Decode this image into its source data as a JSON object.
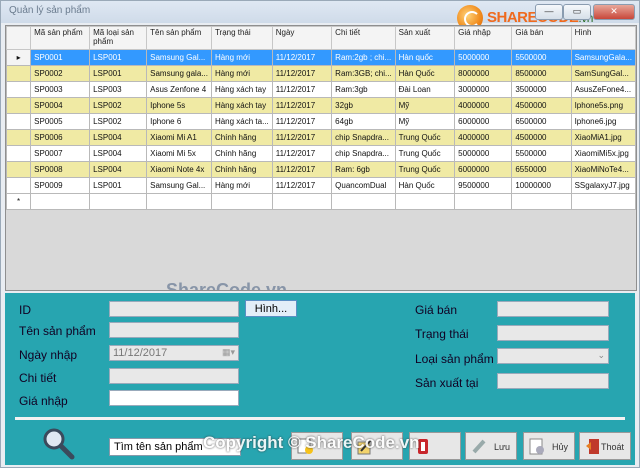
{
  "window": {
    "title": "Quản lý sản phẩm",
    "minimize_label": "—",
    "maximize_label": "▭",
    "close_label": "✕"
  },
  "logo": {
    "text": "SHARECODE",
    "suffix": ".vn"
  },
  "grid": {
    "columns": [
      "Mã sản phẩm",
      "Mã loại sản phẩm",
      "Tên sản phẩm",
      "Trạng thái",
      "Ngày",
      "Chi tiết",
      "Sản xuất",
      "Giá nhập",
      "Giá bán",
      "Hình"
    ],
    "rows": [
      [
        "SP0001",
        "LSP001",
        "Samsung Gal...",
        "Hàng mới",
        "11/12/2017",
        "Ram:2gb ; chi...",
        "Hàn quốc",
        "5000000",
        "5500000",
        "SamsungGala..."
      ],
      [
        "SP0002",
        "LSP001",
        "Samsung gala...",
        "Hàng mới",
        "11/12/2017",
        "Ram:3GB; chi...",
        "Hàn Quốc",
        "8000000",
        "8500000",
        "SamSungGal..."
      ],
      [
        "SP0003",
        "LSP003",
        "Asus Zenfone 4",
        "Hàng xách tay",
        "11/12/2017",
        "Ram:3gb",
        "Đài Loan",
        "3000000",
        "3500000",
        "AsusZeFone4..."
      ],
      [
        "SP0004",
        "LSP002",
        "Iphone 5s",
        "Hàng xách tay",
        "11/12/2017",
        "32gb",
        "Mỹ",
        "4000000",
        "4500000",
        "Iphone5s.png"
      ],
      [
        "SP0005",
        "LSP002",
        "Iphone 6",
        "Hàng xách ta...",
        "11/12/2017",
        "64gb",
        "Mỹ",
        "6000000",
        "6500000",
        "Iphone6.jpg"
      ],
      [
        "SP0006",
        "LSP004",
        "Xiaomi Mi A1",
        "Chính hãng",
        "11/12/2017",
        "chip Snapdra...",
        "Trung Quốc",
        "4000000",
        "4500000",
        "XiaoMiA1.jpg"
      ],
      [
        "SP0007",
        "LSP004",
        "Xiaomi Mi 5x",
        "Chính hãng",
        "11/12/2017",
        "chip Snapdra...",
        "Trung Quốc",
        "5000000",
        "5500000",
        "XiaomiMi5x.jpg"
      ],
      [
        "SP0008",
        "LSP004",
        "Xiaomi Note 4x",
        "Chính hãng",
        "11/12/2017",
        "Ram: 6gb",
        "Trung Quốc",
        "6000000",
        "6550000",
        "XiaoMiNoTe4..."
      ],
      [
        "SP0009",
        "LSP001",
        "Samsung Gal...",
        "Hàng mới",
        "11/12/2017",
        "QuancomDual",
        "Hàn Quốc",
        "9500000",
        "10000000",
        "SSgalaxyJ7.jpg"
      ]
    ],
    "selected_marker": "▸",
    "new_row_marker": "*"
  },
  "watermark_center": "ShareCode.vn",
  "form": {
    "id_label": "ID",
    "name_label": "Tên sản phẩm",
    "date_label": "Ngày nhập",
    "detail_label": "Chi tiết",
    "import_price_label": "Giá nhập",
    "date_value": "11/12/2017",
    "image_button": "Hình...",
    "sale_price_label": "Giá bán",
    "status_label": "Trạng thái",
    "category_label": "Loại sản phẩm",
    "origin_label": "Sản xuất tại"
  },
  "search": {
    "value": "Tìm tên sản phẩm"
  },
  "actions": {
    "save_label": "Lưu",
    "cancel_label": "Hủy",
    "exit_label": "Thoát"
  },
  "watermark_copyright": "Copyright © ShareCode.vn",
  "colors": {
    "panel": "#27a5b0",
    "selected_row": "#3399ff",
    "alt_row": "#f0eaa4"
  }
}
